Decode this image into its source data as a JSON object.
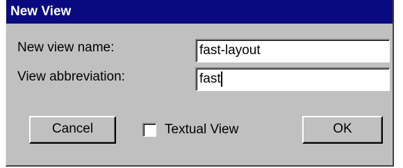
{
  "dialog": {
    "title": "New View"
  },
  "form": {
    "view_name_label": "New view name:",
    "view_name_value": "fast-layout",
    "abbreviation_label": "View abbreviation:",
    "abbreviation_value": "fast"
  },
  "actions": {
    "cancel_label": "Cancel",
    "textual_view_label": "Textual View",
    "textual_view_checked": false,
    "ok_label": "OK"
  },
  "colors": {
    "title_bar": "#0a0a80",
    "dialog_face": "#c0c0c0"
  }
}
